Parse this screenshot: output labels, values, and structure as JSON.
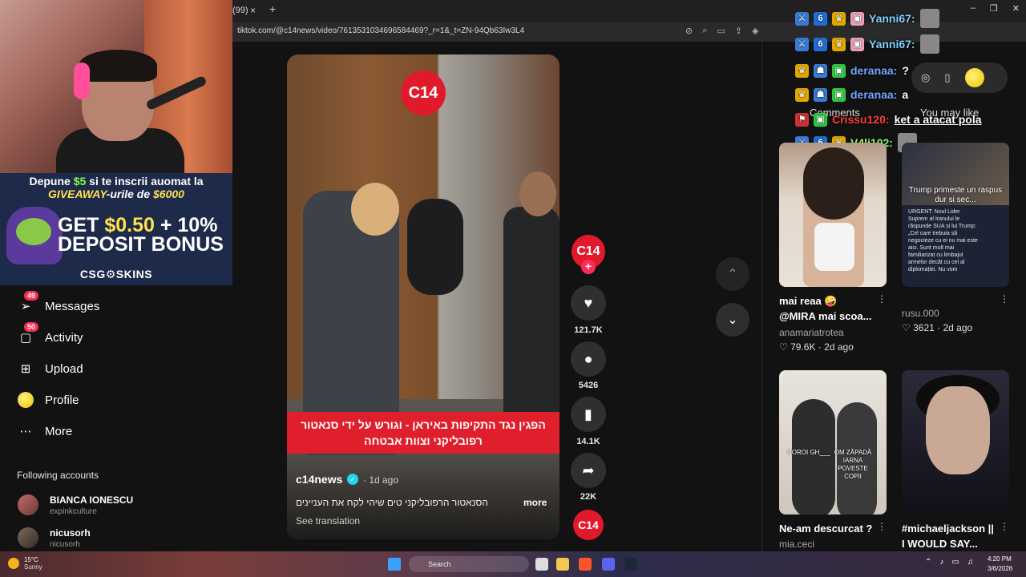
{
  "browser": {
    "tab_count": "(99)",
    "tab_close": "×",
    "new_tab": "+",
    "url": "tiktok.com/@c14news/video/7613531034696584469?_r=1&_t=ZN-94Qb63Iw3L4",
    "window_controls": [
      "–",
      "❐",
      "✕"
    ]
  },
  "stream_overlay": {
    "promo": {
      "line1_prefix": "Depune ",
      "line1_amount": "$5",
      "line1_suffix": " si te inscrii auomat la",
      "line2_prefix": "GIVEAWAY",
      "line2_suffix": "-urile de ",
      "line2_amount": "$6000",
      "get_prefix": "GET ",
      "get_amount": "$0.50",
      "get_suffix": " + 10%",
      "bonus": "DEPOSIT BONUS",
      "brand": "CSG⚙SKINS"
    },
    "chat": [
      {
        "user": "Yanni67:",
        "message": "",
        "color": "#7fd0ff"
      },
      {
        "user": "Yanni67:",
        "message": "",
        "color": "#7fd0ff"
      },
      {
        "user": "deranaa:",
        "message": "?",
        "color": "#6fa8ff"
      },
      {
        "user": "deranaa:",
        "message": "a",
        "color": "#6fa8ff"
      },
      {
        "user": "Crissu120:",
        "message": "ket a atacat pola",
        "color": "#ff3b3b"
      },
      {
        "user": "V4li102:",
        "message": "",
        "color": "#8cff6a"
      }
    ]
  },
  "sidebar": {
    "items": [
      {
        "label": "Messages",
        "icon": "send-icon",
        "badge": "49"
      },
      {
        "label": "Activity",
        "icon": "inbox-icon",
        "badge": "50"
      },
      {
        "label": "Upload",
        "icon": "plus-square-icon",
        "badge": ""
      },
      {
        "label": "Profile",
        "icon": "profile-icon",
        "badge": ""
      },
      {
        "label": "More",
        "icon": "more-icon",
        "badge": ""
      }
    ],
    "following_title": "Following accounts",
    "accounts": [
      {
        "name": "BIANCA IONESCU",
        "handle": "expinkculture"
      },
      {
        "name": "nicusorh",
        "handle": "nicusorh"
      }
    ]
  },
  "video": {
    "logo": "C14",
    "caption": "הפגין נגד התקיפות באיראן - וגורש על ידי סנאטור רפובליקני וצוות אבטחה",
    "author": "c14news",
    "verified": "✓",
    "time": "· 1d ago",
    "description": "הסנאטור הרפובליקני טים שיהי לקח את העניינים",
    "more": "more",
    "see_translation": "See translation"
  },
  "actions": {
    "avatar_label": "C14",
    "follow": "+",
    "likes": "121.7K",
    "comments": "5426",
    "saves": "14.1K",
    "shares": "22K",
    "sound_label": "C14"
  },
  "navigation": {
    "up": "⌃",
    "down": "⌄"
  },
  "right_panel": {
    "tabs": [
      "Comments",
      "You may like"
    ],
    "recommendations": [
      {
        "title_line1": "mai reaa 🤪",
        "title_line2": "@MIRA mai scoa...",
        "author": "anamariatrotea",
        "likes": "79.6K",
        "age": "2d ago"
      },
      {
        "title_line1": "",
        "title_line2": "",
        "author": "rusu.000",
        "likes": "3621",
        "age": "2d ago",
        "thumb_headline": "Trump primeste un raspus dur si sec...",
        "thumb_body": "URGENT: Noul Lider Suprem al Iranului le răspunde SUA și lui Trump: „Cel care trebuia să negocieze cu ei nu mai este aici. Sunt mult mai familiarizat cu limbajul armelor decât cu cel al diplomației. Nu vom"
      },
      {
        "title_line1": "Ne-am descurcat ?",
        "title_line2": "",
        "author": "mia.ceci",
        "likes": "",
        "age": "",
        "thumb_cap1": "NOROI GH___",
        "thumb_cap2": "OM ZĂPADĂ IARNA POVESTE COPII"
      },
      {
        "title_line1": "#michaeljackson ||",
        "title_line2": "I WOULD SAY...",
        "author": "",
        "likes": "",
        "age": ""
      }
    ]
  },
  "taskbar": {
    "temperature": "15°C",
    "condition": "Sunny",
    "search_label": "Search",
    "time": "4:20 PM",
    "date": "3/6/2026"
  }
}
